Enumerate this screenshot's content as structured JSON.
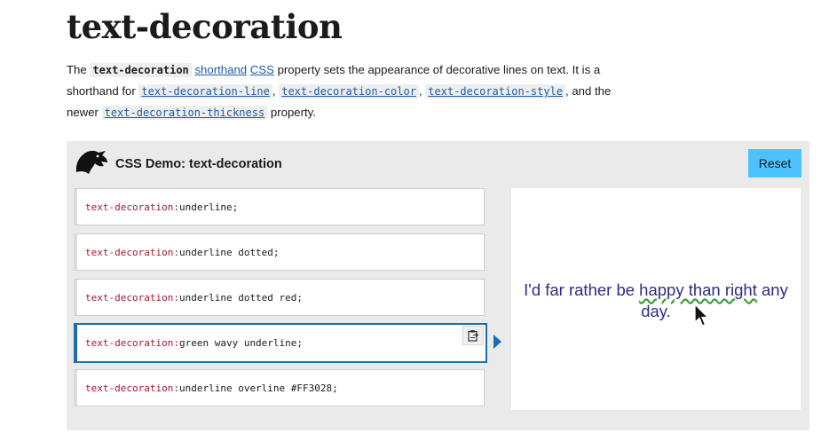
{
  "page": {
    "title": "text-decoration",
    "intro": {
      "p1": "The",
      "code_name": "text-decoration",
      "link_shorthand": "shorthand",
      "link_css": "CSS",
      "p2": "property sets the appearance of decorative lines on text. It is a shorthand for",
      "code_line": "text-decoration-line",
      "sep1": ",",
      "code_color": "text-decoration-color",
      "sep2": ",",
      "code_style": "text-decoration-style",
      "p3": ", and the newer",
      "code_thickness": "text-decoration-thickness",
      "p4": "property."
    }
  },
  "demo": {
    "title": "CSS Demo: text-decoration",
    "reset_label": "Reset",
    "logo_icon": "dino-head-icon",
    "options": [
      {
        "prop": "text-decoration:",
        "value": " underline;",
        "selected": false
      },
      {
        "prop": "text-decoration:",
        "value": " underline dotted;",
        "selected": false
      },
      {
        "prop": "text-decoration:",
        "value": " underline dotted red;",
        "selected": false
      },
      {
        "prop": "text-decoration:",
        "value": " green wavy underline;",
        "selected": true
      },
      {
        "prop": "text-decoration:",
        "value": " underline overline #FF3028;",
        "selected": false
      }
    ],
    "copy_icon": "clipboard-icon",
    "output": {
      "before": "I'd far rather be ",
      "decorated": "happy than right",
      "after": " any day."
    }
  },
  "colors": {
    "accent": "#1b6fb0",
    "reset_button": "#4cc3ff",
    "property_name": "#a11a2e",
    "output_text": "#2d2d86",
    "wavy_underline": "#2e9a2e",
    "demo_background": "#eaeaea"
  }
}
